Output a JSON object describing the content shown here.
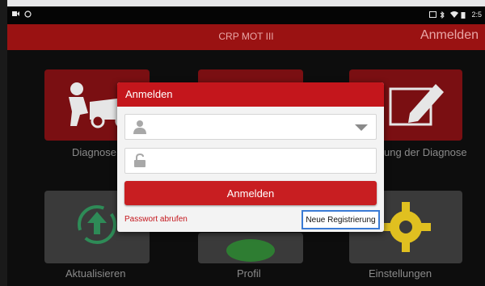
{
  "status_bar": {
    "time": "2:5"
  },
  "header": {
    "title": "CRP MOT III",
    "login_link": "Anmelden"
  },
  "tiles": {
    "diagnose": "Diagnose",
    "review": "ung der Diagnose",
    "update": "Aktualisieren",
    "profile": "Profil",
    "settings": "Einstellungen"
  },
  "dialog": {
    "title": "Anmelden",
    "username_value": "",
    "password_value": "",
    "login_button": "Anmelden",
    "forgot_password": "Passwort abrufen",
    "register_button": "Neue Registrierung"
  },
  "colors": {
    "brand_red": "#c4161c",
    "header_red": "#9a1212",
    "register_border": "#3a7bd5"
  },
  "icons": [
    "user-icon",
    "lock-icon",
    "dropdown-arrow-icon",
    "car-repair-icon",
    "pencil-icon",
    "update-icon",
    "profile-icon",
    "gear-icon"
  ]
}
